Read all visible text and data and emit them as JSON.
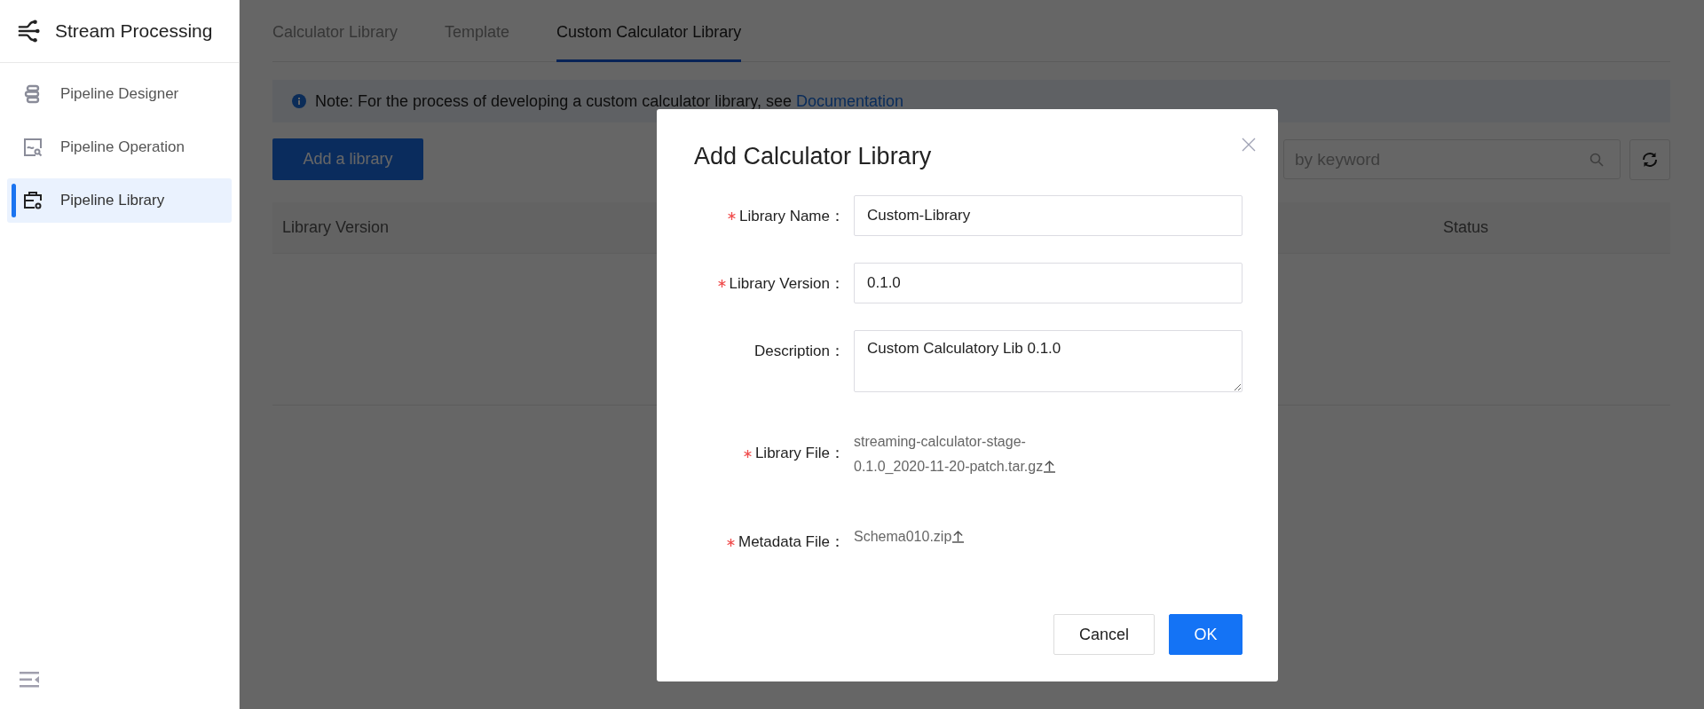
{
  "sidebar": {
    "title": "Stream Processing",
    "items": [
      {
        "label": "Pipeline Designer",
        "selected": false
      },
      {
        "label": "Pipeline Operation",
        "selected": false
      },
      {
        "label": "Pipeline Library",
        "selected": true
      }
    ]
  },
  "tabs": [
    {
      "label": "Calculator Library",
      "selected": false
    },
    {
      "label": "Template",
      "selected": false
    },
    {
      "label": "Custom Calculator Library",
      "selected": true
    }
  ],
  "note": {
    "text": "Note: For the process of developing a custom calculator library, see",
    "link": "Documentation"
  },
  "add_button": "Add a library",
  "search": {
    "placeholder": "by keyword"
  },
  "table": {
    "columns": [
      "Library Version",
      "Status"
    ]
  },
  "dialog": {
    "title": "Add Calculator Library",
    "fields": [
      {
        "kind": "input",
        "label": "Library Name：",
        "required": true,
        "value": "Custom-Library"
      },
      {
        "kind": "input",
        "label": "Library Version：",
        "required": true,
        "value": "0.1.0"
      },
      {
        "kind": "textarea",
        "label": "Description：",
        "required": false,
        "value": "Custom Calculatory Lib 0.1.0"
      },
      {
        "kind": "file",
        "label": "Library File：",
        "required": true,
        "value": "streaming-calculator-stage-0.1.0_2020-11-20-patch.tar.gz"
      },
      {
        "kind": "file",
        "label": "Metadata File：",
        "required": true,
        "value": "Schema010.zip"
      }
    ],
    "buttons": [
      {
        "label": "Cancel",
        "kind": "secondary"
      },
      {
        "label": "OK",
        "kind": "primary"
      }
    ]
  }
}
